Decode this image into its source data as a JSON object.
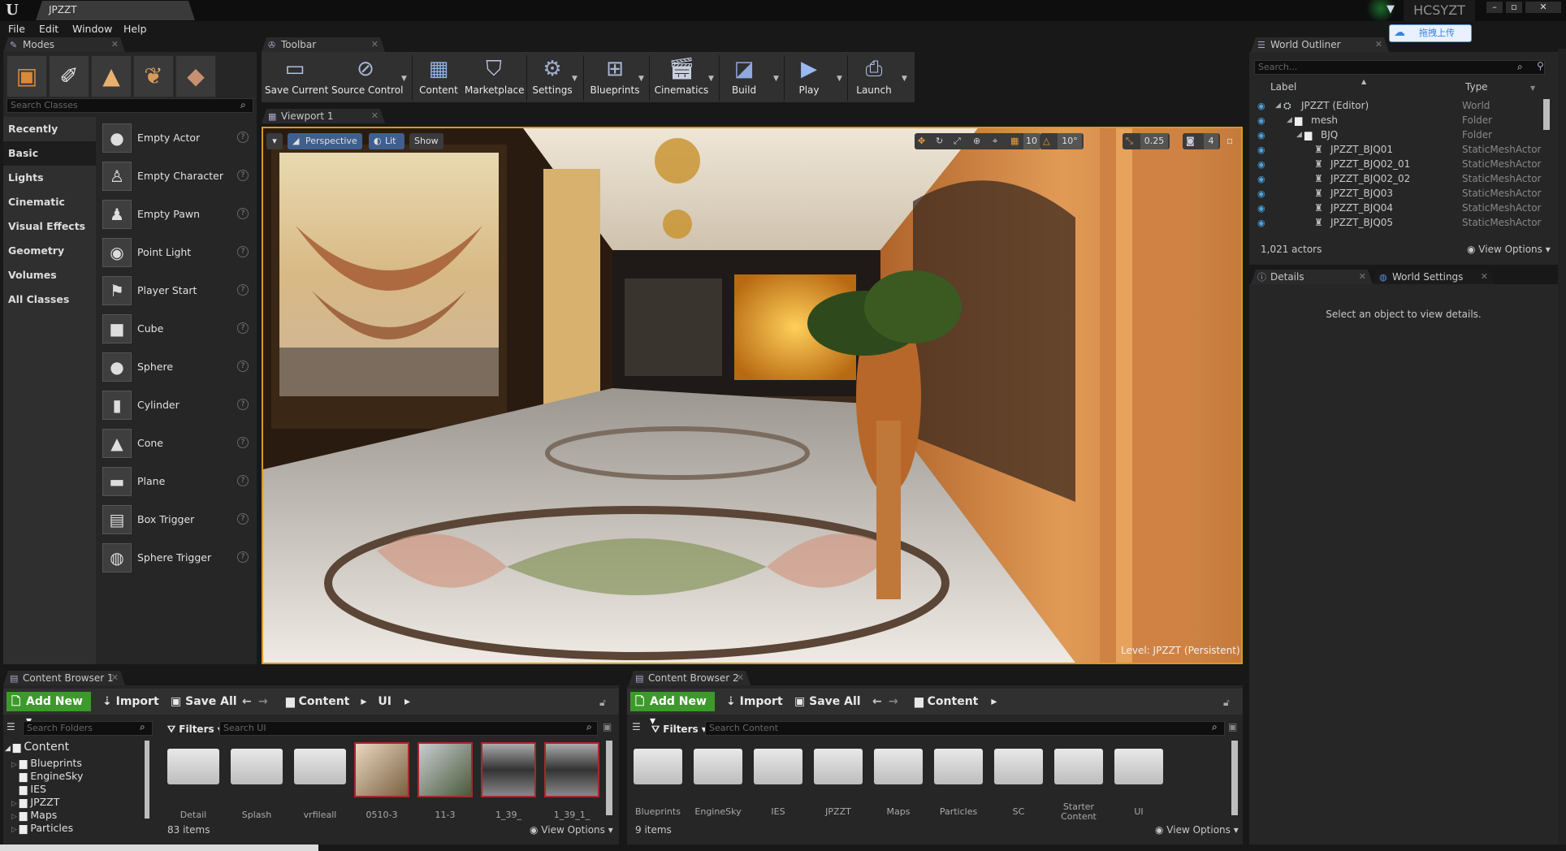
{
  "title_bar": {
    "doc_tab": "JPZZT",
    "user": "HCSYZT",
    "upload_button": "拖拽上传"
  },
  "menu": [
    "File",
    "Edit",
    "Window",
    "Help"
  ],
  "modes": {
    "tab": "Modes",
    "search_placeholder": "Search Classes",
    "categories": [
      "Recently Placed",
      "Basic",
      "Lights",
      "Cinematic",
      "Visual Effects",
      "Geometry",
      "Volumes",
      "All Classes"
    ],
    "selected_category": "Basic",
    "items": [
      "Empty Actor",
      "Empty Character",
      "Empty Pawn",
      "Point Light",
      "Player Start",
      "Cube",
      "Sphere",
      "Cylinder",
      "Cone",
      "Plane",
      "Box Trigger",
      "Sphere Trigger"
    ]
  },
  "toolbar": {
    "tab": "Toolbar",
    "buttons": [
      "Save Current",
      "Source Control",
      "Content",
      "Marketplace",
      "Settings",
      "Blueprints",
      "Cinematics",
      "Build",
      "Play",
      "Launch"
    ]
  },
  "viewport": {
    "tab": "Viewport 1",
    "perspective": "Perspective",
    "lit": "Lit",
    "show": "Show",
    "grid_snap": "10",
    "rotation_snap": "10°",
    "scale_snap": "0.25",
    "camera_speed": "4",
    "level_label": "Level:",
    "level_name": "JPZZT (Persistent)"
  },
  "outliner": {
    "tab": "World Outliner",
    "search_placeholder": "Search...",
    "col_label": "Label",
    "col_type": "Type",
    "rows": [
      {
        "label": "JPZZT (Editor)",
        "type": "World"
      },
      {
        "label": "mesh",
        "type": "Folder"
      },
      {
        "label": "BJQ",
        "type": "Folder"
      },
      {
        "label": "JPZZT_BJQ01",
        "type": "StaticMeshActor"
      },
      {
        "label": "JPZZT_BJQ02_01",
        "type": "StaticMeshActor"
      },
      {
        "label": "JPZZT_BJQ02_02",
        "type": "StaticMeshActor"
      },
      {
        "label": "JPZZT_BJQ03",
        "type": "StaticMeshActor"
      },
      {
        "label": "JPZZT_BJQ04",
        "type": "StaticMeshActor"
      },
      {
        "label": "JPZZT_BJQ05",
        "type": "StaticMeshActor"
      }
    ],
    "actor_count": "1,021 actors",
    "view_options": "View Options"
  },
  "details": {
    "tab1": "Details",
    "tab2": "World Settings",
    "empty_message": "Select an object to view details."
  },
  "cb1": {
    "tab": "Content Browser 1",
    "add_new": "Add New",
    "import": "Import",
    "save_all": "Save All",
    "path": [
      "Content",
      "UI"
    ],
    "folder_search": "Search Folders",
    "filters": "Filters",
    "search_placeholder": "Search UI",
    "tree_root": "Content",
    "tree": [
      "Blueprints",
      "EngineSky",
      "IES",
      "JPZZT",
      "Maps",
      "Particles"
    ],
    "assets": [
      "Detail",
      "Splash",
      "vrfileall",
      "0510-3",
      "11-3",
      "1_39_",
      "1_39_1_"
    ],
    "count": "83 items",
    "view_options": "View Options"
  },
  "cb2": {
    "tab": "Content Browser 2",
    "add_new": "Add New",
    "import": "Import",
    "save_all": "Save All",
    "path": [
      "Content"
    ],
    "filters": "Filters",
    "search_placeholder": "Search Content",
    "folders": [
      "Blueprints",
      "EngineSky",
      "IES",
      "JPZZT",
      "Maps",
      "Particles",
      "SC",
      "Starter Content",
      "UI"
    ],
    "count": "9 items",
    "view_options": "View Options"
  }
}
